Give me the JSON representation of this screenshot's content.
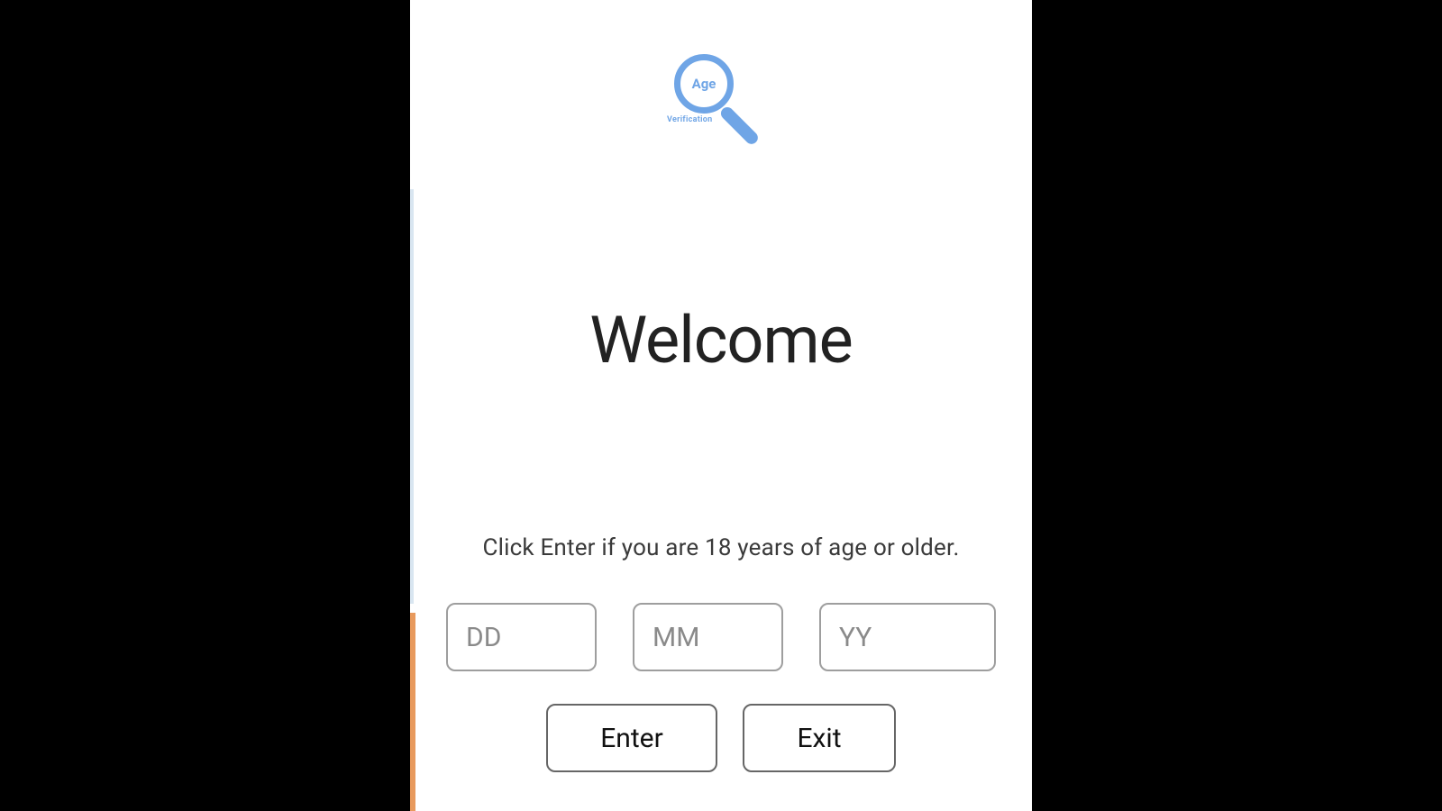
{
  "logo": {
    "circle_text": "Age",
    "sub_text": "Verification"
  },
  "heading": "Welcome",
  "instruction": "Click Enter if you are 18 years of age or older.",
  "date": {
    "dd_placeholder": "DD",
    "mm_placeholder": "MM",
    "yy_placeholder": "YY"
  },
  "buttons": {
    "enter": "Enter",
    "exit": "Exit"
  },
  "colors": {
    "accent_blue": "#6fa5e6",
    "edge_orange": "#e89a5d"
  }
}
